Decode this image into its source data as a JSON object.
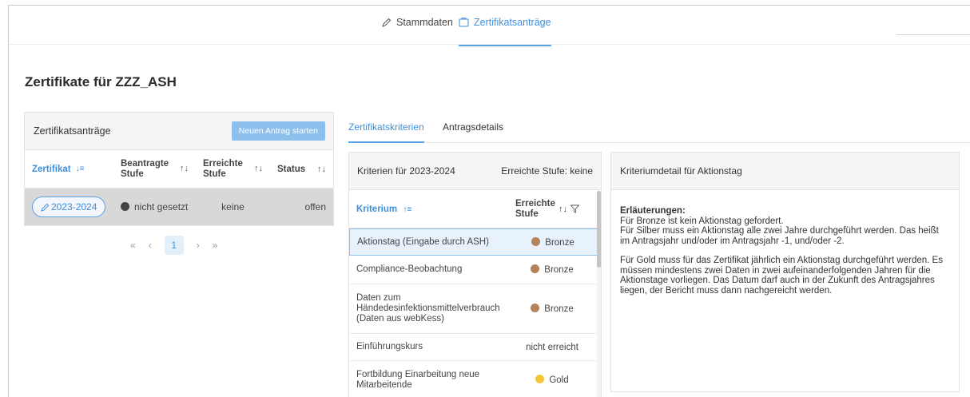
{
  "top_tabs": [
    {
      "label": "Stammdaten",
      "active": false
    },
    {
      "label": "Zertifikatsanträge",
      "active": true
    }
  ],
  "page_title": "Zertifikate für ZZZ_ASH",
  "left_card": {
    "title": "Zertifikatsanträge",
    "new_button": "Neuen Antrag starten",
    "columns": [
      "Zertifikat",
      "Beantragte Stufe",
      "Erreichte Stufe",
      "Status"
    ],
    "rows": [
      {
        "zertifikat": "2023-2024",
        "beantragte_stufe": "nicht gesetzt",
        "erreichte_stufe": "keine",
        "status": "offen"
      }
    ],
    "pager": {
      "first": "«",
      "prev": "‹",
      "page": "1",
      "next": "›",
      "last": "»"
    }
  },
  "sub_tabs": [
    {
      "label": "Zertifikatskriterien",
      "active": true
    },
    {
      "label": "Antragsdetails",
      "active": false
    }
  ],
  "criteria_card": {
    "title": "Kriterien für 2023-2024",
    "reached": "Erreichte Stufe: keine",
    "col_kriterium": "Kriterium",
    "col_stufe": "Erreichte Stufe",
    "rows": [
      {
        "name": "Aktionstag (Eingabe durch ASH)",
        "stufe": "Bronze",
        "dot": "#b5835a",
        "selected": true
      },
      {
        "name": "Compliance-Beobachtung",
        "stufe": "Bronze",
        "dot": "#b5835a",
        "selected": false
      },
      {
        "name": "Daten zum Händedesinfektionsmittelverbrauch (Daten aus webKess)",
        "stufe": "Bronze",
        "dot": "#b5835a",
        "selected": false
      },
      {
        "name": "Einführungskurs",
        "stufe": "nicht erreicht",
        "dot": "",
        "selected": false
      },
      {
        "name": "Fortbildung Einarbeitung neue Mitarbeitende",
        "stufe": "Gold",
        "dot": "#f2c83a",
        "selected": false
      }
    ]
  },
  "detail_card": {
    "title": "Kriteriumdetail für Aktionstag",
    "label": "Erläuterungen:",
    "p1": "Für Bronze ist kein Aktionstag gefordert.",
    "p2": "Für Silber muss ein Aktionstag alle zwei Jahre durchgeführt werden. Das heißt im Antragsjahr und/oder im Antragsjahr -1, und/oder -2.",
    "p3": "Für Gold muss für das Zertifikat jährlich ein Aktionstag durchgeführt werden. Es müssen mindestens zwei Daten in zwei aufeinanderfolgenden Jahren für die Aktionstage vorliegen. Das Datum darf auch in der Zukunft des Antragsjahres liegen, der Bericht muss dann nachgereicht werden."
  },
  "colors": {
    "accent": "#3d8fe0",
    "bronze": "#b5835a",
    "gold": "#f2c83a",
    "status_dark": "#444444"
  }
}
